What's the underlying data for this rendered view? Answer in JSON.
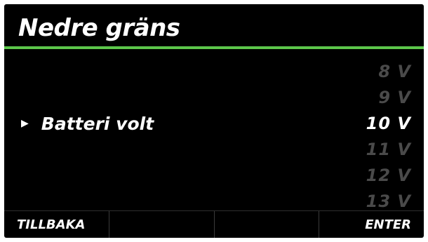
{
  "header": {
    "title": "Nedre gräns",
    "accent_color": "#5cc64a"
  },
  "setting": {
    "label": "Batteri volt",
    "marker_icon": "right-triangle-icon",
    "selected_value": "10 V"
  },
  "values": [
    {
      "text": "8 V",
      "color": "#4a4a4a"
    },
    {
      "text": "9 V",
      "color": "#4a4a4a"
    },
    {
      "text": "10 V",
      "color": "#ffffff"
    },
    {
      "text": "11 V",
      "color": "#4a4a4a"
    },
    {
      "text": "12 V",
      "color": "#4a4a4a"
    },
    {
      "text": "13 V",
      "color": "#4a4a4a"
    }
  ],
  "softkeys": [
    {
      "label": "TILLBAKA"
    },
    {
      "label": ""
    },
    {
      "label": ""
    },
    {
      "label": "ENTER"
    }
  ]
}
